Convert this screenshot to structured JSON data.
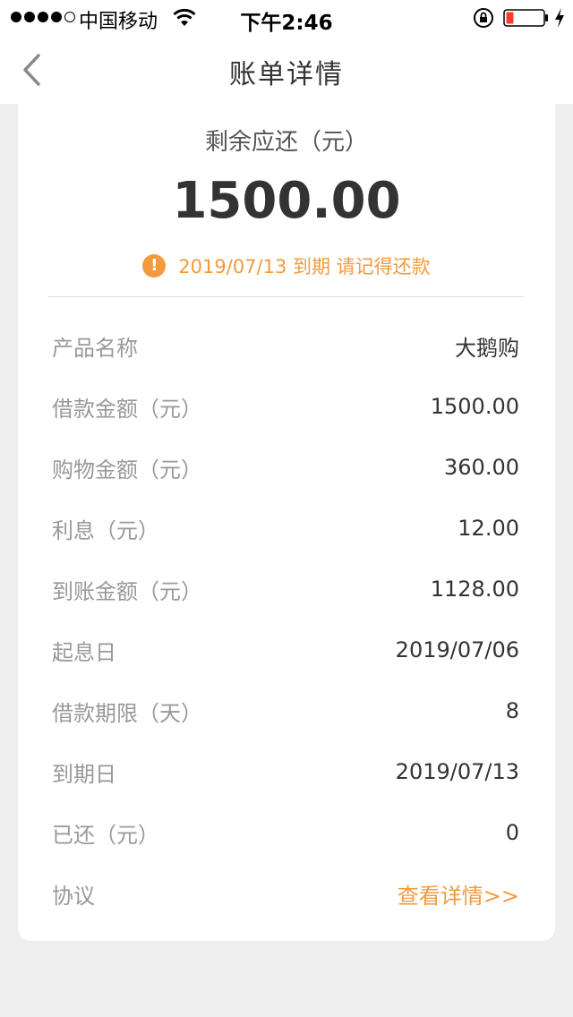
{
  "status_bar": {
    "carrier": "中国移动",
    "time": "下午2:46",
    "signal_filled": 4,
    "signal_total": 5,
    "battery_level": 0.2
  },
  "nav": {
    "title": "账单详情"
  },
  "summary": {
    "remaining_label": "剩余应还（元）",
    "remaining_amount": "1500.00",
    "due_notice": "2019/07/13 到期 请记得还款",
    "warning_glyph": "!"
  },
  "details": [
    {
      "label": "产品名称",
      "value": "大鹅购"
    },
    {
      "label": "借款金额（元）",
      "value": "1500.00"
    },
    {
      "label": "购物金额（元）",
      "value": "360.00"
    },
    {
      "label": "利息（元）",
      "value": "12.00"
    },
    {
      "label": "到账金额（元）",
      "value": "1128.00"
    },
    {
      "label": "起息日",
      "value": "2019/07/06"
    },
    {
      "label": "借款期限（天）",
      "value": "8"
    },
    {
      "label": "到期日",
      "value": "2019/07/13"
    },
    {
      "label": "已还（元）",
      "value": "0"
    },
    {
      "label": "协议",
      "value": "查看详情>>"
    }
  ],
  "colors": {
    "accent": "#f39a3d",
    "background": "#eeeeee",
    "card": "#ffffff",
    "text_primary": "#333333",
    "text_secondary": "#999999"
  }
}
